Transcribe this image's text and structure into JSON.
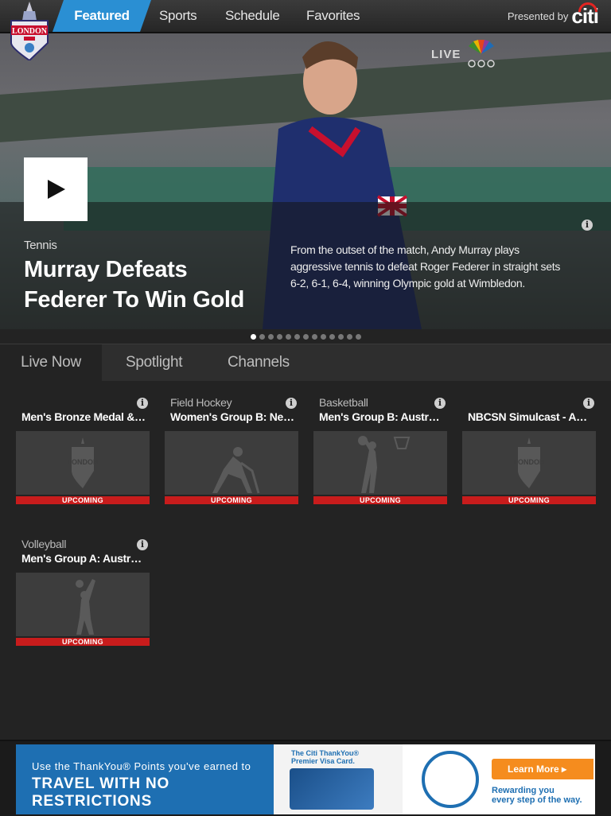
{
  "nav": {
    "tabs": [
      {
        "label": "Featured"
      },
      {
        "label": "Sports"
      },
      {
        "label": "Schedule"
      },
      {
        "label": "Favorites"
      }
    ],
    "presented_by": "Presented by",
    "sponsor": "citi"
  },
  "hero": {
    "category": "Tennis",
    "title": "Murray Defeats Federer To Win Gold",
    "description": "From the outset of the match, Andy Murray plays aggressive tennis to defeat Roger Federer in straight sets 6-2, 6-1, 6-4, winning Olympic gold at Wimbledon.",
    "live_label": "LIVE",
    "slide_count": 13,
    "active_slide": 1
  },
  "subtabs": [
    {
      "label": "Live Now"
    },
    {
      "label": "Spotlight"
    },
    {
      "label": "Channels"
    }
  ],
  "cards": [
    {
      "category": "",
      "name": "Men's Bronze Medal &Wo...",
      "status": "UPCOMING",
      "icon": "london-2012-logo-icon"
    },
    {
      "category": "Field Hockey",
      "name": "Women's Group B: New Z...",
      "status": "UPCOMING",
      "icon": "field-hockey-icon"
    },
    {
      "category": "Basketball",
      "name": "Men's Group B: Austral...",
      "status": "UPCOMING",
      "icon": "basketball-icon"
    },
    {
      "category": "",
      "name": "NBCSN Simulcast - Augu...",
      "status": "UPCOMING",
      "icon": "london-2012-logo-icon"
    },
    {
      "category": "Volleyball",
      "name": "Men's Group A: Austral...",
      "status": "UPCOMING",
      "icon": "volleyball-icon"
    }
  ],
  "ad": {
    "line1": "Use the ThankYou® Points you've earned to",
    "line2": "TRAVEL WITH NO RESTRICTIONS",
    "card_title": "The Citi ThankYou® Premier Visa Card.",
    "cta": "Learn More ▸",
    "tagline_1": "Rewarding you",
    "tagline_2": "every step of the way."
  },
  "colors": {
    "accent": "#2a8fd3",
    "upcoming": "#c81c1c",
    "citi_red": "#e52421"
  }
}
